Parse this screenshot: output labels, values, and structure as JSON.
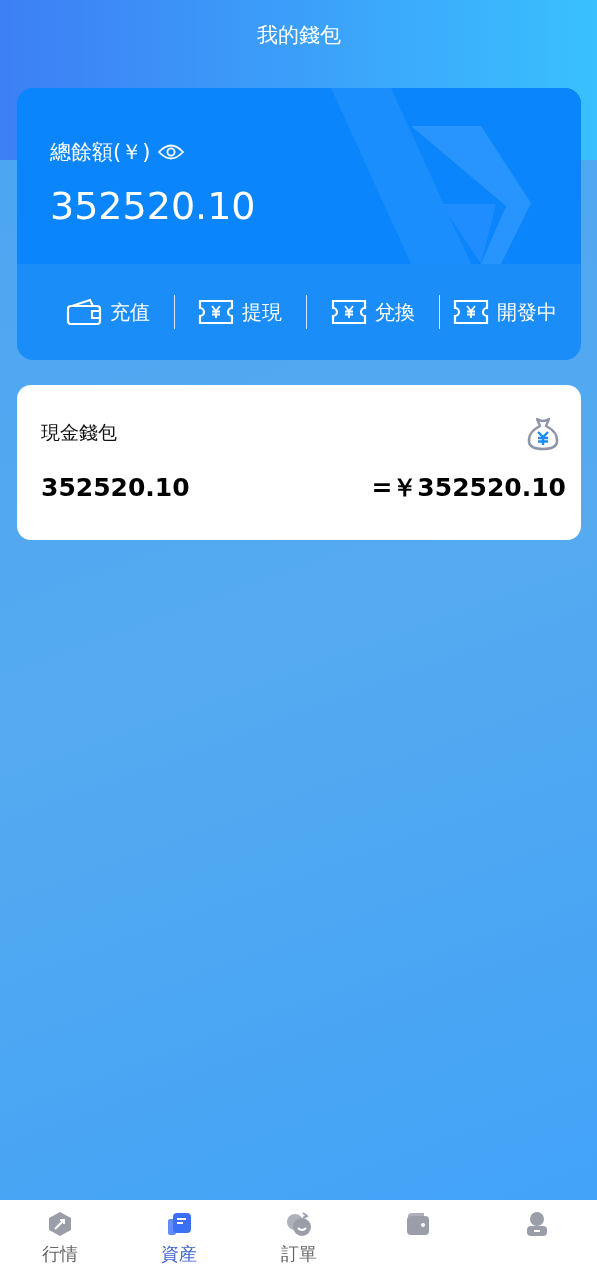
{
  "header": {
    "title": "我的錢包"
  },
  "balance_card": {
    "label": "總餘額(￥)",
    "amount": "352520.10",
    "actions": [
      {
        "kind": "wallet",
        "label": "充值"
      },
      {
        "kind": "ticket",
        "label": "提現"
      },
      {
        "kind": "ticket",
        "label": "兌換"
      },
      {
        "kind": "ticket",
        "label": "開發中"
      }
    ]
  },
  "wallets": [
    {
      "name": "現金錢包",
      "amount": "352520.10",
      "converted": "=￥352520.10"
    }
  ],
  "tab_bar": [
    {
      "kind": "market",
      "label": "行情",
      "selected": false
    },
    {
      "kind": "assets",
      "label": "資産",
      "selected": true
    },
    {
      "kind": "orders",
      "label": "訂單",
      "selected": false
    },
    {
      "kind": "wallet",
      "selected": false
    },
    {
      "kind": "user",
      "selected": false
    }
  ]
}
